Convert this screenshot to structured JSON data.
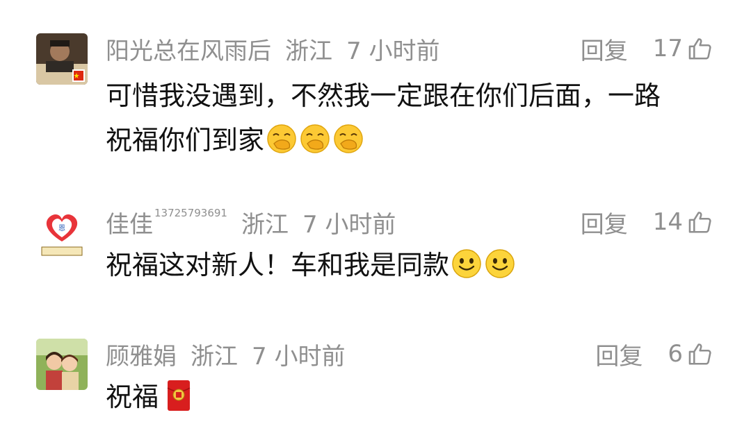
{
  "comments": [
    {
      "username": "阳光总在风雨后",
      "username_suffix": "",
      "location": "浙江",
      "time": "7 小时前",
      "reply_label": "回复",
      "likes": "17",
      "text": "可惜我没遇到，不然我一定跟在你们后面，一路",
      "text_line2": "祝福你们到家",
      "emoji": "facepalm-emoji",
      "emoji_count": 3
    },
    {
      "username": "佳佳",
      "username_suffix": "13725793691",
      "location": "浙江",
      "time": "7 小时前",
      "reply_label": "回复",
      "likes": "14",
      "text": "祝福这对新人！车和我是同款",
      "emoji": "smile-emoji",
      "emoji_count": 2
    },
    {
      "username": "顾雅娟",
      "username_suffix": "",
      "location": "浙江",
      "time": "7 小时前",
      "reply_label": "回复",
      "likes": "6",
      "text": "祝福",
      "emoji": "red-envelope-icon",
      "emoji_count": 1
    }
  ],
  "icons": {
    "like": "thumbs-up-icon"
  },
  "colors": {
    "meta_text": "#8f8f8f",
    "body_text": "#111111"
  }
}
